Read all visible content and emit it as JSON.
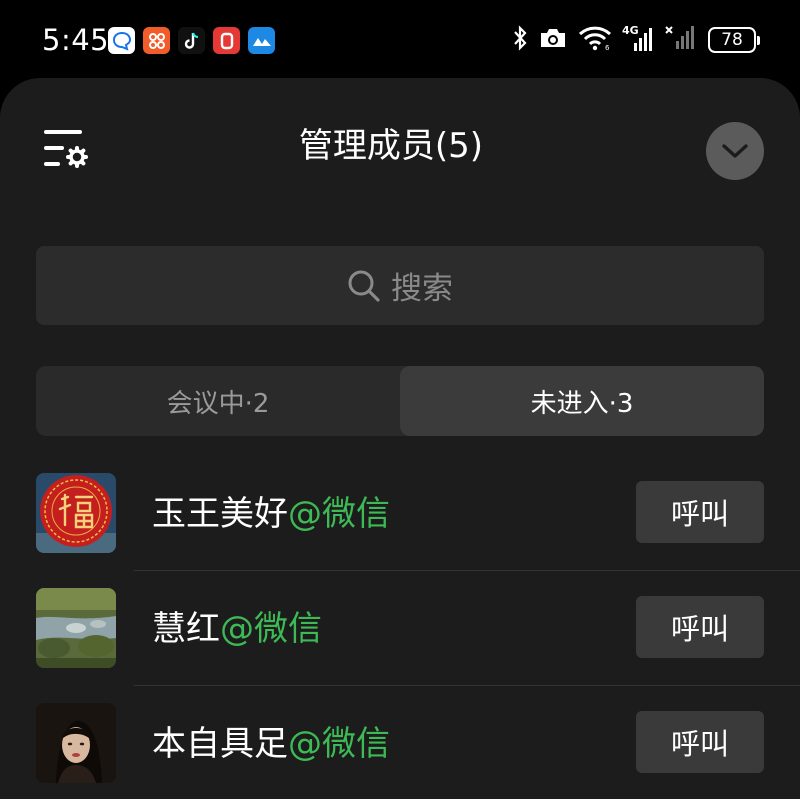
{
  "status_bar": {
    "time": "5:45",
    "notification_apps": [
      {
        "icon": "chat-bubble-app-icon",
        "color": "#1a73e8",
        "glyph": "Q"
      },
      {
        "icon": "orange-app-icon",
        "color": "#f25c2a",
        "glyph": "88"
      },
      {
        "icon": "tiktok-icon",
        "color": "#111111",
        "glyph": "♪"
      },
      {
        "icon": "red-app-icon",
        "color": "#e53935",
        "glyph": "0"
      },
      {
        "icon": "blue-mountain-app-icon",
        "color": "#1e88e5",
        "glyph": "▲"
      }
    ],
    "network": "4G",
    "battery": "78"
  },
  "sheet": {
    "title": "管理成员(5)",
    "search": {
      "placeholder": "搜索"
    },
    "tabs": [
      {
        "label": "会议中·2",
        "active": false
      },
      {
        "label": "未进入·3",
        "active": true
      }
    ],
    "members": [
      {
        "name": "玉王美好",
        "source": "@微信",
        "action": "呼叫",
        "avatar": "fu-character-avatar"
      },
      {
        "name": "慧红",
        "source": "@微信",
        "action": "呼叫",
        "avatar": "stream-rocks-avatar"
      },
      {
        "name": "本自具足",
        "source": "@微信",
        "action": "呼叫",
        "avatar": "portrait-avatar"
      }
    ]
  },
  "colors": {
    "sheet_background": "#1c1c1c",
    "accent_green": "#3dba55",
    "button_background": "#3a3a3a"
  }
}
